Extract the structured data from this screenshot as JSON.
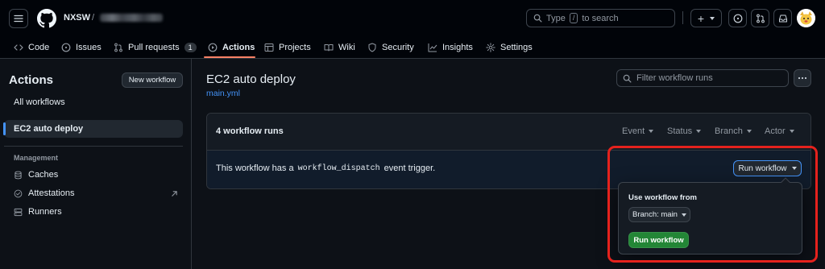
{
  "header": {
    "owner": "NXSW",
    "separator": "/",
    "search_placeholder_prefix": "Type",
    "search_key": "/",
    "search_placeholder_suffix": "to search",
    "plus_label": "+"
  },
  "tabs": [
    {
      "label": "Code",
      "icon": "code-icon"
    },
    {
      "label": "Issues",
      "icon": "issue-icon"
    },
    {
      "label": "Pull requests",
      "icon": "pull-request-icon",
      "count": "1"
    },
    {
      "label": "Actions",
      "icon": "play-icon",
      "active": true
    },
    {
      "label": "Projects",
      "icon": "table-icon"
    },
    {
      "label": "Wiki",
      "icon": "book-icon"
    },
    {
      "label": "Security",
      "icon": "shield-icon"
    },
    {
      "label": "Insights",
      "icon": "graph-icon"
    },
    {
      "label": "Settings",
      "icon": "gear-icon"
    }
  ],
  "sidebar": {
    "title": "Actions",
    "new_workflow_label": "New workflow",
    "all_workflows_label": "All workflows",
    "selected_workflow_label": "EC2 auto deploy",
    "management_heading": "Management",
    "management_items": [
      {
        "label": "Caches",
        "icon": "database-icon"
      },
      {
        "label": "Attestations",
        "icon": "verified-icon"
      },
      {
        "label": "Runners",
        "icon": "server-icon"
      }
    ]
  },
  "main": {
    "title": "EC2 auto deploy",
    "file_link": "main.yml",
    "filter_placeholder": "Filter workflow runs",
    "runs_count_label": "4 workflow runs",
    "filters": [
      "Event",
      "Status",
      "Branch",
      "Actor"
    ],
    "dispatch_text_before": "This workflow has a",
    "dispatch_code": "workflow_dispatch",
    "dispatch_text_after": "event trigger.",
    "run_workflow_label": "Run workflow"
  },
  "popover": {
    "heading": "Use workflow from",
    "branch_label": "Branch: main",
    "submit_label": "Run workflow"
  },
  "colors": {
    "accent_link": "#4493f8",
    "primary_green": "#238636",
    "highlight_red": "#e5221d",
    "active_tab_underline": "#f78166"
  }
}
